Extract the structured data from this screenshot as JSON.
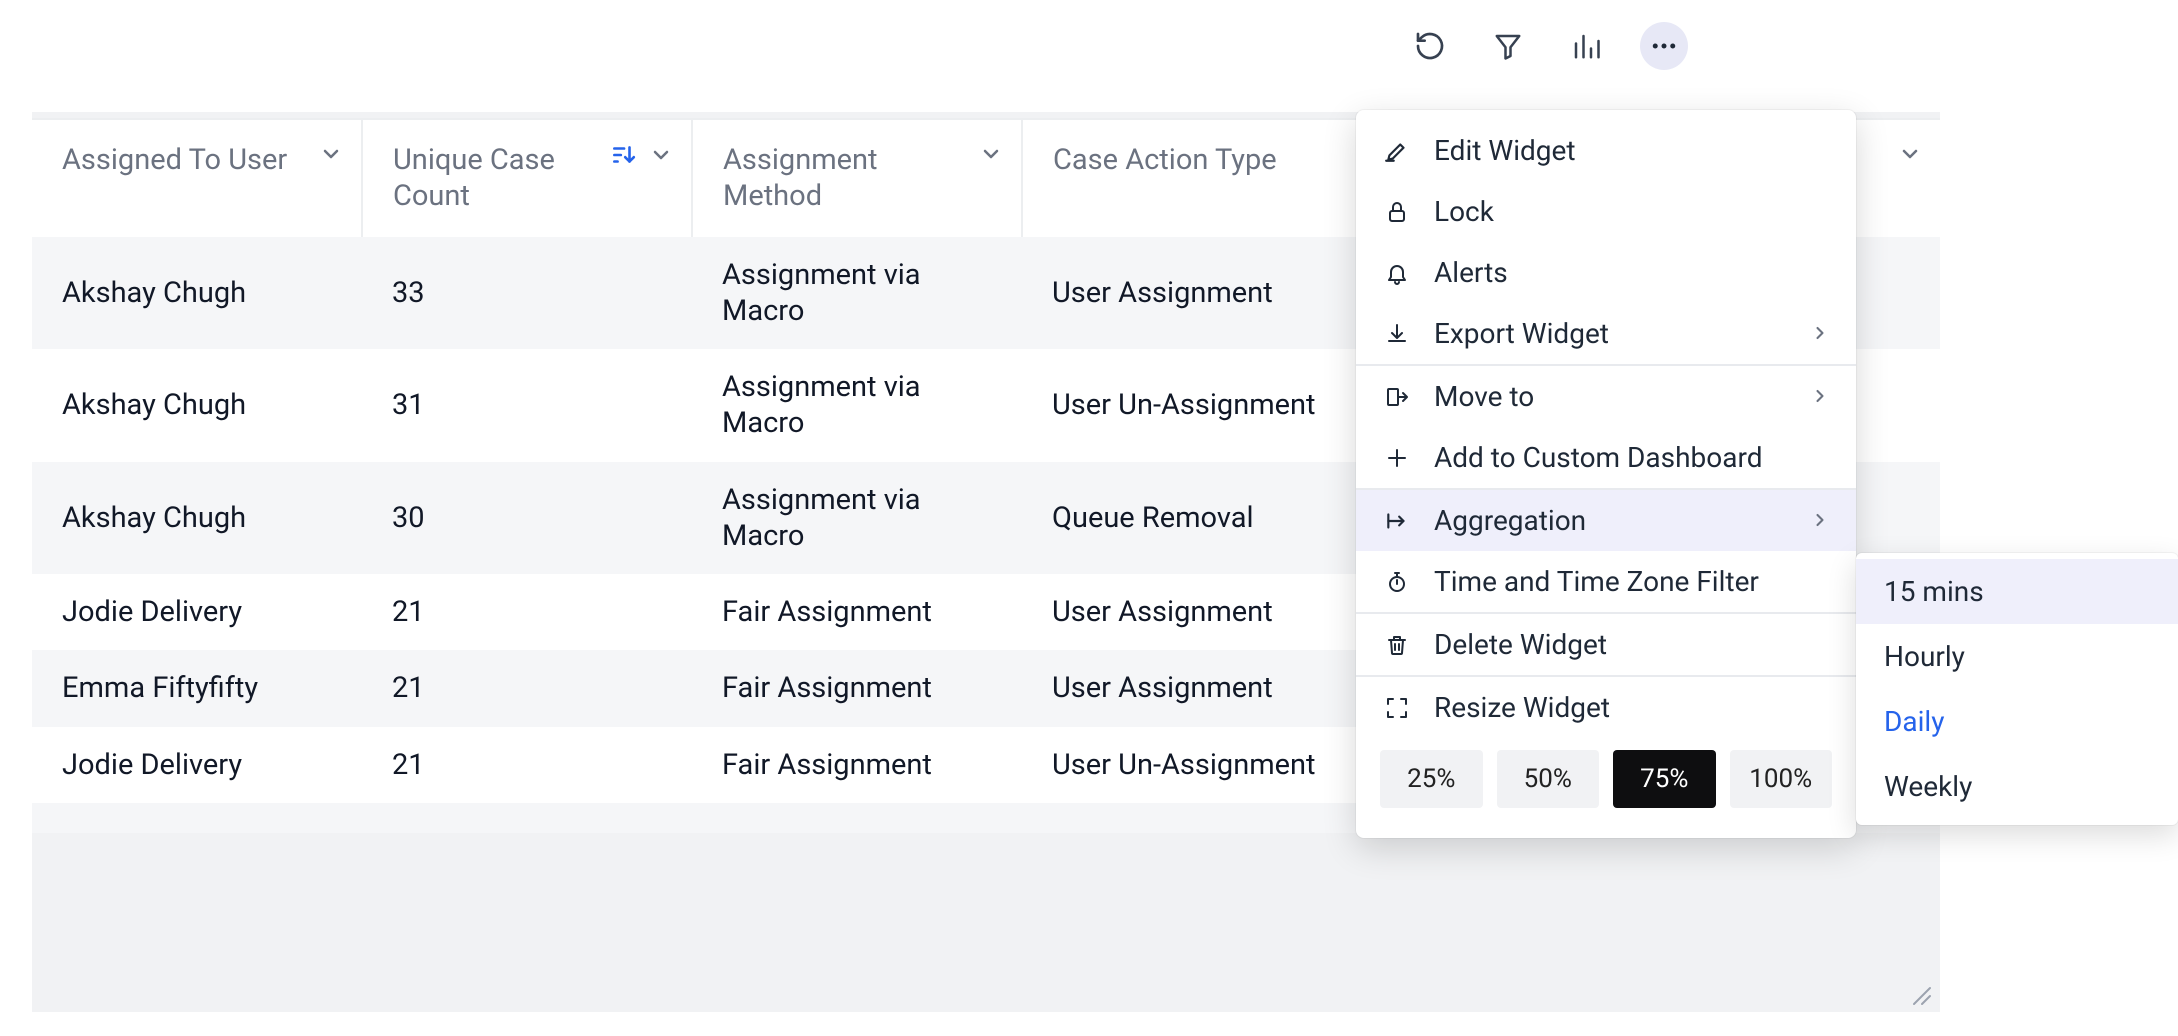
{
  "toolbar": {
    "refresh_icon": "refresh",
    "filter_icon": "filter",
    "chart_icon": "bar-chart",
    "more_icon": "more"
  },
  "table": {
    "columns": [
      {
        "label": "Assigned To User",
        "sort": false
      },
      {
        "label": "Unique Case Count",
        "sort": true
      },
      {
        "label": "Assignment Method",
        "sort": false
      },
      {
        "label": "Case Action Type",
        "sort": false
      }
    ],
    "rows": [
      {
        "user": "Akshay Chugh",
        "count": "33",
        "method": "Assignment via Macro",
        "action": "User Assignment"
      },
      {
        "user": "Akshay Chugh",
        "count": "31",
        "method": "Assignment via Macro",
        "action": "User Un-Assignment"
      },
      {
        "user": "Akshay Chugh",
        "count": "30",
        "method": "Assignment via Macro",
        "action": "Queue Removal"
      },
      {
        "user": "Jodie Delivery",
        "count": "21",
        "method": "Fair Assignment",
        "action": "User Assignment"
      },
      {
        "user": "Emma Fiftyfifty",
        "count": "21",
        "method": "Fair Assignment",
        "action": "User Assignment"
      },
      {
        "user": "Jodie Delivery",
        "count": "21",
        "method": "Fair Assignment",
        "action": "User Un-Assignment"
      }
    ]
  },
  "menu": {
    "edit": "Edit Widget",
    "lock": "Lock",
    "alerts": "Alerts",
    "export": "Export Widget",
    "move": "Move to",
    "add": "Add to Custom Dashboard",
    "aggregation": "Aggregation",
    "timezone": "Time and Time Zone Filter",
    "delete": "Delete Widget",
    "resize_label": "Resize Widget",
    "resize_options": [
      "25%",
      "50%",
      "75%",
      "100%"
    ],
    "resize_active_index": 2
  },
  "submenu": {
    "items": [
      "15 mins",
      "Hourly",
      "Daily",
      "Weekly"
    ],
    "hover_index": 0,
    "selected_index": 2
  }
}
